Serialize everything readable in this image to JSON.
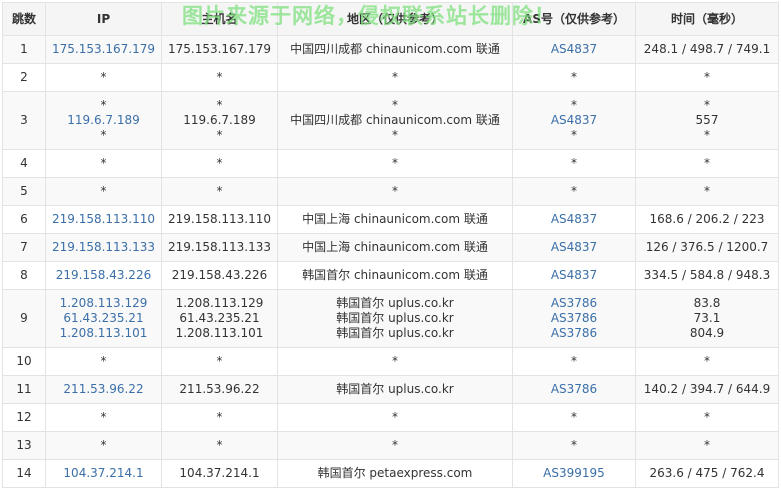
{
  "watermark": "图片来源于网络，侵权联系站长删除！",
  "headers": [
    "跳数",
    "IP",
    "主机名",
    "地区（仅供参考）",
    "AS号（仅供参考）",
    "时间（毫秒）"
  ],
  "hops": [
    {
      "hop": "1",
      "ip": [
        "175.153.167.179"
      ],
      "host": [
        "175.153.167.179"
      ],
      "region": [
        "中国四川成都 chinaunicom.com 联通"
      ],
      "as": [
        "AS4837"
      ],
      "time": [
        "248.1 / 498.7 / 749.1"
      ]
    },
    {
      "hop": "2",
      "ip": [
        "*"
      ],
      "host": [
        "*"
      ],
      "region": [
        "*"
      ],
      "as": [
        "*"
      ],
      "time": [
        "*"
      ]
    },
    {
      "hop": "3",
      "ip": [
        "*",
        "119.6.7.189",
        "*"
      ],
      "host": [
        "*",
        "119.6.7.189",
        "*"
      ],
      "region": [
        "*",
        "中国四川成都 chinaunicom.com 联通",
        "*"
      ],
      "as": [
        "*",
        "AS4837",
        "*"
      ],
      "time": [
        "*",
        "557",
        "*"
      ]
    },
    {
      "hop": "4",
      "ip": [
        "*"
      ],
      "host": [
        "*"
      ],
      "region": [
        "*"
      ],
      "as": [
        "*"
      ],
      "time": [
        "*"
      ]
    },
    {
      "hop": "5",
      "ip": [
        "*"
      ],
      "host": [
        "*"
      ],
      "region": [
        "*"
      ],
      "as": [
        "*"
      ],
      "time": [
        "*"
      ]
    },
    {
      "hop": "6",
      "ip": [
        "219.158.113.110"
      ],
      "host": [
        "219.158.113.110"
      ],
      "region": [
        "中国上海 chinaunicom.com 联通"
      ],
      "as": [
        "AS4837"
      ],
      "time": [
        "168.6 / 206.2 / 223"
      ]
    },
    {
      "hop": "7",
      "ip": [
        "219.158.113.133"
      ],
      "host": [
        "219.158.113.133"
      ],
      "region": [
        "中国上海 chinaunicom.com 联通"
      ],
      "as": [
        "AS4837"
      ],
      "time": [
        "126 / 376.5 / 1200.7"
      ]
    },
    {
      "hop": "8",
      "ip": [
        "219.158.43.226"
      ],
      "host": [
        "219.158.43.226"
      ],
      "region": [
        "韩国首尔 chinaunicom.com 联通"
      ],
      "as": [
        "AS4837"
      ],
      "time": [
        "334.5 / 584.8 / 948.3"
      ]
    },
    {
      "hop": "9",
      "ip": [
        "1.208.113.129",
        "61.43.235.21",
        "1.208.113.101"
      ],
      "host": [
        "1.208.113.129",
        "61.43.235.21",
        "1.208.113.101"
      ],
      "region": [
        "韩国首尔 uplus.co.kr",
        "韩国首尔 uplus.co.kr",
        "韩国首尔 uplus.co.kr"
      ],
      "as": [
        "AS3786",
        "AS3786",
        "AS3786"
      ],
      "time": [
        "83.8",
        "73.1",
        "804.9"
      ]
    },
    {
      "hop": "10",
      "ip": [
        "*"
      ],
      "host": [
        "*"
      ],
      "region": [
        "*"
      ],
      "as": [
        "*"
      ],
      "time": [
        "*"
      ]
    },
    {
      "hop": "11",
      "ip": [
        "211.53.96.22"
      ],
      "host": [
        "211.53.96.22"
      ],
      "region": [
        "韩国首尔 uplus.co.kr"
      ],
      "as": [
        "AS3786"
      ],
      "time": [
        "140.2 / 394.7 / 644.9"
      ]
    },
    {
      "hop": "12",
      "ip": [
        "*"
      ],
      "host": [
        "*"
      ],
      "region": [
        "*"
      ],
      "as": [
        "*"
      ],
      "time": [
        "*"
      ]
    },
    {
      "hop": "13",
      "ip": [
        "*"
      ],
      "host": [
        "*"
      ],
      "region": [
        "*"
      ],
      "as": [
        "*"
      ],
      "time": [
        "*"
      ]
    },
    {
      "hop": "14",
      "ip": [
        "104.37.214.1"
      ],
      "host": [
        "104.37.214.1"
      ],
      "region": [
        "韩国首尔 petaexpress.com"
      ],
      "as": [
        "AS399195"
      ],
      "time": [
        "263.6 / 475 / 762.4"
      ]
    }
  ]
}
